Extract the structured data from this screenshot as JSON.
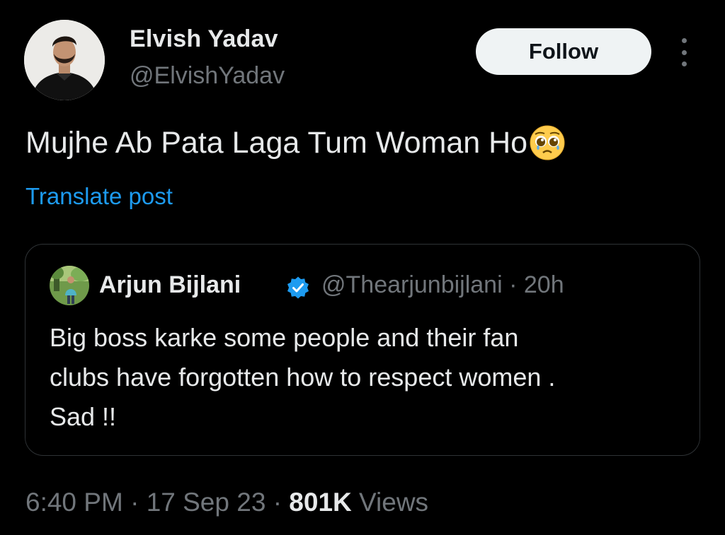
{
  "tweet": {
    "author": {
      "name": "Elvish Yadav",
      "handle": "@ElvishYadav"
    },
    "follow_label": "Follow",
    "text": "Mujhe Ab Pata Laga Tum Woman Ho",
    "emoji": "pleading-face",
    "translate_label": "Translate post",
    "quote": {
      "author_name": "Arjun Bijlani",
      "author_handle": "@Thearjunbijlani",
      "time": "20h",
      "verified": true,
      "text_lines": [
        "Big boss karke some people and their fan",
        "clubs have forgotten how to respect women .",
        "Sad !!"
      ]
    },
    "meta": {
      "time": "6:40 PM",
      "date": "17 Sep 23",
      "views_count": "801K",
      "views_label": "Views"
    }
  },
  "colors": {
    "background": "#000000",
    "primary_text": "#e7e9ea",
    "secondary_text": "#71767b",
    "link": "#1d9bf0",
    "border": "#2f3336",
    "follow_bg": "#eff3f4"
  }
}
